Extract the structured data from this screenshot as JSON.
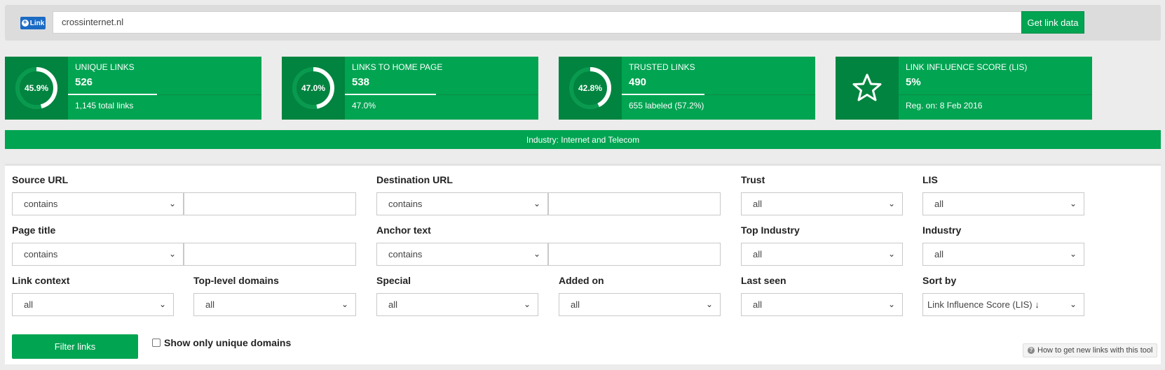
{
  "topbar": {
    "badge_label": "Link",
    "url_value": "crossinternet.nl",
    "get_button": "Get link data"
  },
  "cards": [
    {
      "percent_label": "45.9%",
      "fraction": 0.459,
      "title": "UNIQUE LINKS",
      "value": "526",
      "sub": "1,145 total links"
    },
    {
      "percent_label": "47.0%",
      "fraction": 0.47,
      "title": "LINKS TO HOME PAGE",
      "value": "538",
      "sub": "47.0%"
    },
    {
      "percent_label": "42.8%",
      "fraction": 0.428,
      "title": "TRUSTED LINKS",
      "value": "490",
      "sub": "655 labeled (57.2%)"
    },
    {
      "icon": "star-icon",
      "title": "LINK INFLUENCE SCORE (LIS)",
      "value": "5%",
      "sub": "Reg. on: 8 Feb 2016"
    }
  ],
  "industry_text": "Industry: Internet and Telecom",
  "filters": {
    "source_url": {
      "label": "Source URL",
      "mode": "contains",
      "value": ""
    },
    "destination_url": {
      "label": "Destination URL",
      "mode": "contains",
      "value": ""
    },
    "trust": {
      "label": "Trust",
      "value": "all"
    },
    "lis": {
      "label": "LIS",
      "value": "all"
    },
    "page_title": {
      "label": "Page title",
      "mode": "contains",
      "value": ""
    },
    "anchor_text": {
      "label": "Anchor text",
      "mode": "contains",
      "value": ""
    },
    "top_industry": {
      "label": "Top Industry",
      "value": "all"
    },
    "industry": {
      "label": "Industry",
      "value": "all"
    },
    "link_context": {
      "label": "Link context",
      "value": "all"
    },
    "top_level_domains": {
      "label": "Top-level domains",
      "value": "all"
    },
    "special": {
      "label": "Special",
      "value": "all"
    },
    "added_on": {
      "label": "Added on",
      "value": "all"
    },
    "last_seen": {
      "label": "Last seen",
      "value": "all"
    },
    "sort_by": {
      "label": "Sort by",
      "value": "Link Influence Score (LIS) ↓"
    }
  },
  "filter_button": "Filter links",
  "unique_domains_label": "Show only unique domains",
  "help_link": "How to get new links with this tool",
  "colors": {
    "green": "#00a451",
    "dark_green": "#00843f",
    "blue_badge": "#1a6bc4"
  }
}
